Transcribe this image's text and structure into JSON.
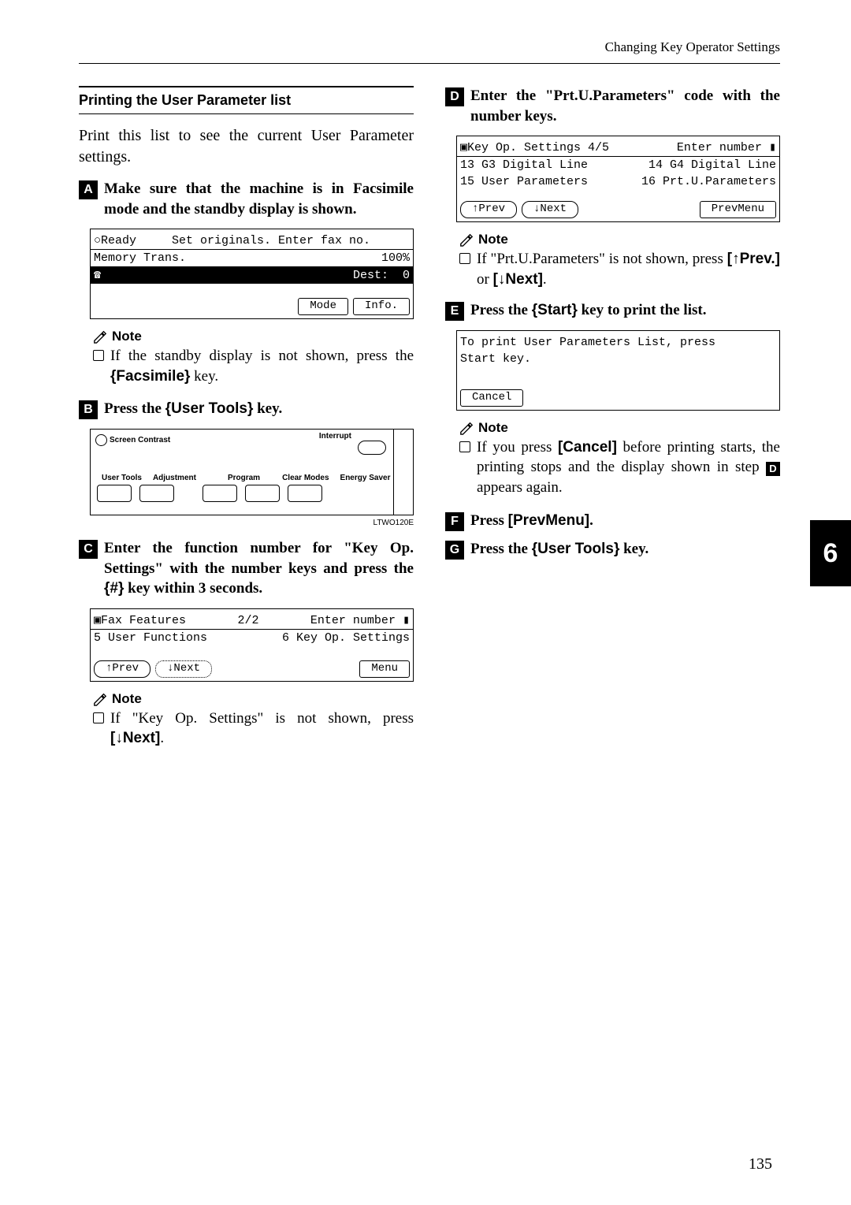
{
  "header": {
    "right_text": "Changing Key Operator Settings"
  },
  "chapter_tab": "6",
  "page_number": "135",
  "left": {
    "section_title": "Printing the User Parameter list",
    "intro": "Print this list to see the current User Parameter settings.",
    "step1": {
      "text_parts": {
        "a": "Make sure that the machine is in Facsimile mode and the standby display is shown."
      },
      "lcd": {
        "row1": "○Ready     Set originals. Enter fax no.",
        "row2_left": "Memory Trans.",
        "row2_right": "100%",
        "row3_right": "Dest:  0",
        "btn_mode": "Mode",
        "btn_info": "Info."
      },
      "note_head": "Note",
      "note_pre": "If the standby display is not shown, press the ",
      "note_key": "Facsimile",
      "note_post": " key."
    },
    "step2": {
      "pre": "Press the ",
      "key": "User Tools",
      "post": " key.",
      "fig": {
        "screen_contrast": "Screen Contrast",
        "interrupt": "Interrupt",
        "labels": [
          "User Tools",
          "Adjustment",
          "Program",
          "Clear Modes",
          "Energy Saver"
        ],
        "figref": "LTWO120E"
      }
    },
    "step3": {
      "pre": "Enter the function number for \"Key Op. Settings\" with the number keys and press the ",
      "key": "#",
      "post": " key within 3 seconds.",
      "lcd": {
        "row1a": "Fax Features",
        "row1b": "2/2",
        "row1c": "Enter number",
        "row2a": "5 User Functions",
        "row2b": "6 Key Op. Settings",
        "btn_prev": "↑Prev",
        "btn_next": "↓Next",
        "btn_menu": "Menu"
      },
      "note_head": "Note",
      "note_pre": "If \"Key Op. Settings\" is not shown, press ",
      "note_key": "[↓Next]",
      "note_post": "."
    }
  },
  "right": {
    "step4": {
      "text": "Enter the \"Prt.U.Parameters\" code with the number keys.",
      "lcd": {
        "row1a": "Key Op. Settings 4/5",
        "row1b": "Enter number",
        "row2a": "13 G3 Digital Line",
        "row2b": "14 G4 Digital Line",
        "row3a": "15 User Parameters",
        "row3b": "16 Prt.U.Parameters",
        "btn_prev": "↑Prev",
        "btn_next": "↓Next",
        "btn_prevmenu": "PrevMenu"
      },
      "note_head": "Note",
      "note_pre": "If \"Prt.U.Parameters\" is not shown, press ",
      "note_key1": "[↑Prev.]",
      "note_mid": " or ",
      "note_key2": "[↓Next]",
      "note_post": "."
    },
    "step5": {
      "pre": "Press the ",
      "key": "Start",
      "post": " key to print the list.",
      "lcd": {
        "row1": "To print User Parameters List, press",
        "row2": "Start key.",
        "btn_cancel": "Cancel"
      },
      "note_head": "Note",
      "note_pre": "If you press ",
      "note_key": "[Cancel]",
      "note_main": " before printing starts, the printing stops and the display shown in step ",
      "note_step": "D",
      "note_post": " appears again."
    },
    "step6": {
      "pre": "Press ",
      "key": "[PrevMenu]",
      "post": "."
    },
    "step7": {
      "pre": "Press the ",
      "key": "User Tools",
      "post": " key."
    }
  }
}
